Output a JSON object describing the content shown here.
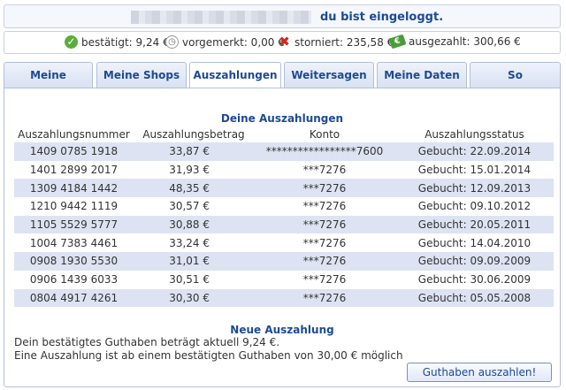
{
  "login": {
    "status_text": "du bist eingeloggt."
  },
  "status": [
    {
      "icon": "check-circle-icon",
      "text": "bestätigt: 9,24 €"
    },
    {
      "icon": "timer-icon",
      "text": "vorgemerkt: 0,00 €"
    },
    {
      "icon": "cross-icon",
      "text": "storniert: 235,58 €"
    },
    {
      "icon": "money-icon",
      "text": "ausgezahlt: 300,66 €"
    }
  ],
  "tabs": [
    {
      "label": "Meine Einkäufe",
      "active": false
    },
    {
      "label": "Meine Shops",
      "active": false
    },
    {
      "label": "Auszahlungen",
      "active": true
    },
    {
      "label": "Weitersagen",
      "active": false
    },
    {
      "label": "Meine Daten",
      "active": false
    },
    {
      "label": "So funktioniert`s",
      "active": false
    }
  ],
  "payouts": {
    "title": "Deine Auszahlungen",
    "columns": [
      "Auszahlungsnummer",
      "Auszahlungsbetrag",
      "Konto",
      "Auszahlungsstatus"
    ],
    "rows": [
      [
        "1409 0785 1918",
        "33,87 €",
        "*****************7600",
        "Gebucht: 22.09.2014"
      ],
      [
        "1401 2899 2017",
        "31,93 €",
        "***7276",
        "Gebucht: 15.01.2014"
      ],
      [
        "1309 4184 1442",
        "48,35 €",
        "***7276",
        "Gebucht: 12.09.2013"
      ],
      [
        "1210 9442 1119",
        "30,57 €",
        "***7276",
        "Gebucht: 09.10.2012"
      ],
      [
        "1105 5529 5777",
        "30,88 €",
        "***7276",
        "Gebucht: 20.05.2011"
      ],
      [
        "1004 7383 4461",
        "33,24 €",
        "***7276",
        "Gebucht: 14.04.2010"
      ],
      [
        "0908 1930 5530",
        "31,01 €",
        "***7276",
        "Gebucht: 09.09.2009"
      ],
      [
        "0906 1439 6033",
        "30,51 €",
        "***7276",
        "Gebucht: 30.06.2009"
      ],
      [
        "0804 4917 4261",
        "30,30 €",
        "***7276",
        "Gebucht: 05.05.2008"
      ]
    ]
  },
  "new_payout": {
    "title": "Neue Auszahlung",
    "line1": "Dein bestätigtes Guthaben beträgt aktuell 9,24 €.",
    "line2": "Eine Auszahlung ist ab einem bestätigten Guthaben von 30,00 € möglich",
    "button_label": "Guthaben auszahlen!"
  },
  "colors": {
    "accent": "#1d4a94",
    "row_alt": "#dde3f2"
  }
}
